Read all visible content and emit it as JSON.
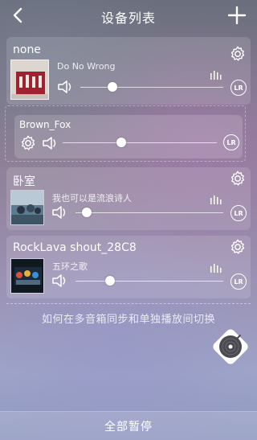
{
  "header": {
    "title": "设备列表",
    "back_icon": "chevron-left-icon",
    "add_icon": "plus-icon"
  },
  "devices": [
    {
      "name": "none",
      "song": "Do No Wrong",
      "volume": 0.2,
      "lr_label": "LR"
    },
    {
      "name": "Brown_Fox",
      "volume": 0.38,
      "lr_label": "LR"
    },
    {
      "name": "卧室",
      "song": "我也可以是流浪诗人",
      "volume": 0.05,
      "lr_label": "LR"
    },
    {
      "name": "RockLava shout_28C8",
      "song": "五环之歌",
      "volume": 0.2,
      "lr_label": "LR"
    }
  ],
  "help_text": "如何在多音箱同步和单独播放间切换",
  "bottom_button": "全部暂停",
  "colors": {
    "accent": "#ffffff",
    "card_bg": "rgba(255,255,255,0.13)"
  }
}
